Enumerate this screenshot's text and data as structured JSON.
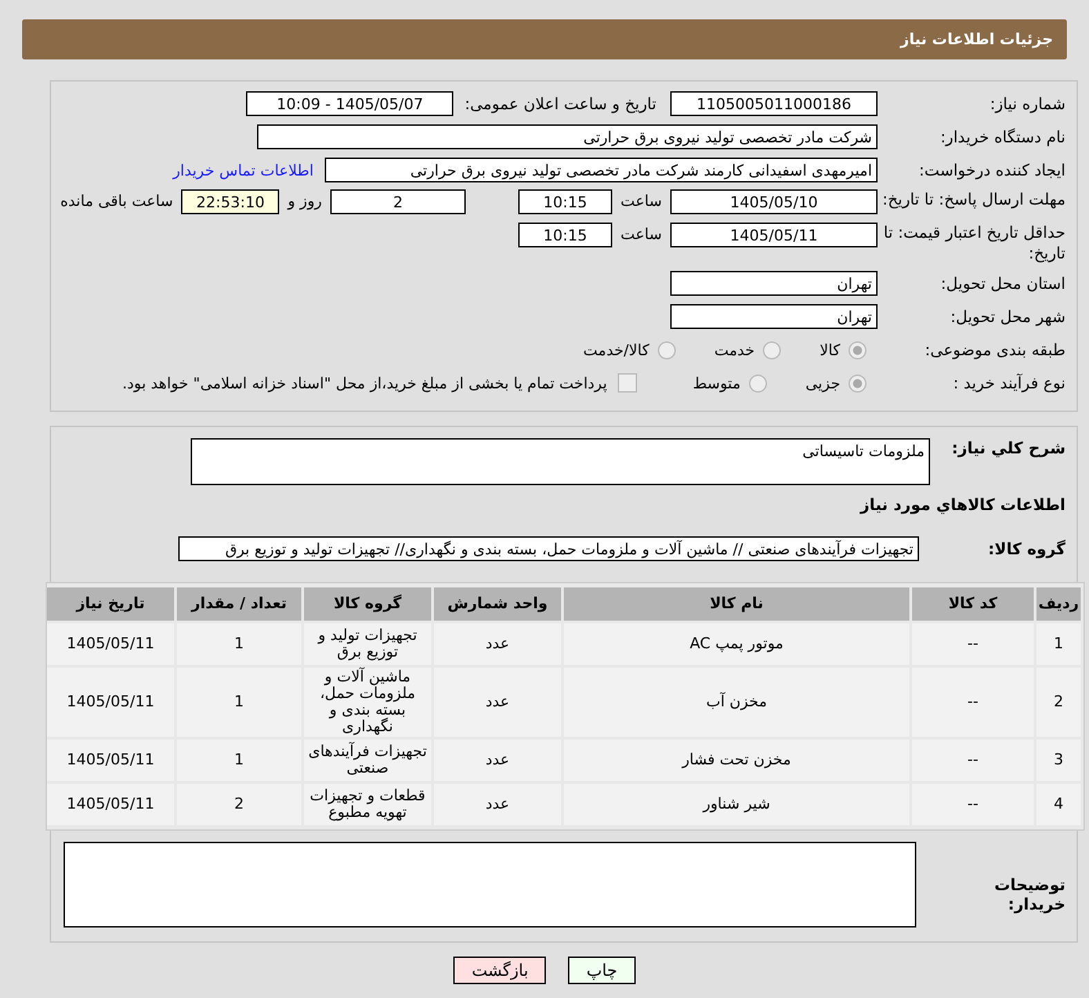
{
  "header": {
    "title": "جزئیات اطلاعات نیاز"
  },
  "need_number": {
    "label": "شماره نیاز:",
    "value": "1105005011000186"
  },
  "announce": {
    "label": "تاریخ و ساعت اعلان عمومی:",
    "value": "1405/05/07 - 10:09"
  },
  "buyer": {
    "label": "نام دستگاه خریدار:",
    "value": "شرکت مادر تخصصی تولید نیروی برق حرارتی"
  },
  "requester": {
    "label": "ایجاد کننده درخواست:",
    "value": "امیرمهدی اسفیدانی کارمند شرکت مادر تخصصی تولید نیروی برق حرارتی",
    "link": "اطلاعات تماس خریدار"
  },
  "deadline": {
    "label": "مهلت ارسال پاسخ: تا تاریخ:",
    "date": "1405/05/10",
    "time_label": "ساعت",
    "time": "10:15",
    "days": "2",
    "days_label": "روز و",
    "remaining": "22:53:10",
    "remaining_label": "ساعت باقی مانده"
  },
  "validity": {
    "label": "حداقل تاریخ اعتبار قیمت: تا تاریخ:",
    "date": "1405/05/11",
    "time_label": "ساعت",
    "time": "10:15"
  },
  "province": {
    "label": "استان محل تحویل:",
    "value": "تهران"
  },
  "city": {
    "label": "شهر محل تحویل:",
    "value": "تهران"
  },
  "category": {
    "label": "طبقه بندی موضوعی:",
    "options": [
      {
        "label": "کالا",
        "selected": true
      },
      {
        "label": "خدمت",
        "selected": false
      },
      {
        "label": "کالا/خدمت",
        "selected": false
      }
    ]
  },
  "process": {
    "label": "نوع فرآیند خرید :",
    "options": [
      {
        "label": "جزیی",
        "selected": true
      },
      {
        "label": "متوسط",
        "selected": false
      }
    ],
    "treasury": {
      "label": "پرداخت تمام یا بخشی از مبلغ خرید،از محل \"اسناد خزانه اسلامی\" خواهد بود.",
      "checked": false
    }
  },
  "description": {
    "label": "شرح کلي نياز:",
    "value": "ملزومات تاسیساتی"
  },
  "goods_title": "اطلاعات کالاهاي مورد نياز",
  "goods_group": {
    "label": "گروه کالا:",
    "value": "تجهیزات فرآیندهای صنعتی // ماشین آلات و ملزومات حمل، بسته بندی و نگهداری// تجهیزات تولید و توزیع برق"
  },
  "table": {
    "columns": [
      "ردیف",
      "کد کالا",
      "نام کالا",
      "واحد شمارش",
      "گروه کالا",
      "تعداد / مقدار",
      "تاریخ نیاز"
    ],
    "rows": [
      [
        "1",
        "--",
        "موتور پمپ AC",
        "عدد",
        "تجهیزات تولید و توزیع برق",
        "1",
        "1405/05/11"
      ],
      [
        "2",
        "--",
        "مخزن آب",
        "عدد",
        "ماشین آلات و ملزومات حمل، بسته بندی و نگهداری",
        "1",
        "1405/05/11"
      ],
      [
        "3",
        "--",
        "مخزن تحت فشار",
        "عدد",
        "تجهیزات فرآیندهای صنعتی",
        "1",
        "1405/05/11"
      ],
      [
        "4",
        "--",
        "شیر شناور",
        "عدد",
        "قطعات و تجهیزات تهویه مطبوع",
        "2",
        "1405/05/11"
      ]
    ]
  },
  "buyer_notes": {
    "label": "توضیحات خریدار:"
  },
  "buttons": [
    {
      "label": "چاپ",
      "kind": "print"
    },
    {
      "label": "بازگشت",
      "kind": "back"
    }
  ]
}
